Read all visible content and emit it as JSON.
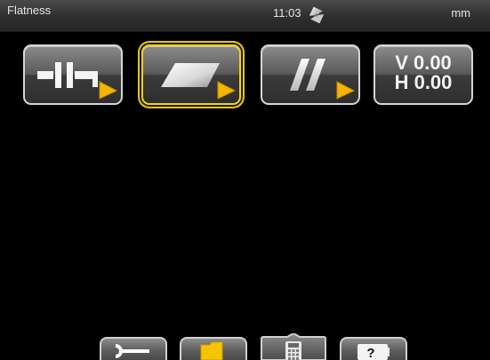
{
  "status_bar": {
    "title": "Flatness",
    "time": "11:03",
    "unit": "mm",
    "icon": "hourglass-icon"
  },
  "mode_buttons": [
    {
      "name": "shaft-alignment",
      "icon": "shaft-coupling-icon",
      "selected": false
    },
    {
      "name": "flatness",
      "icon": "flat-plane-icon",
      "selected": true
    },
    {
      "name": "parallelism",
      "icon": "parallel-lines-icon",
      "selected": false
    },
    {
      "name": "values",
      "selected": false,
      "v_text": "V 0.00",
      "h_text": "H 0.00"
    }
  ],
  "bottom_tabs": [
    {
      "name": "tools",
      "icon": "wrench-icon"
    },
    {
      "name": "files",
      "icon": "folder-icon"
    },
    {
      "name": "calculator",
      "icon": "calculator-icon"
    },
    {
      "name": "help",
      "icon": "help-icon"
    }
  ],
  "colors": {
    "selection": "#f3d11c",
    "play_arrow": "#f6b600",
    "folder": "#f7c400",
    "background": "#000000"
  }
}
